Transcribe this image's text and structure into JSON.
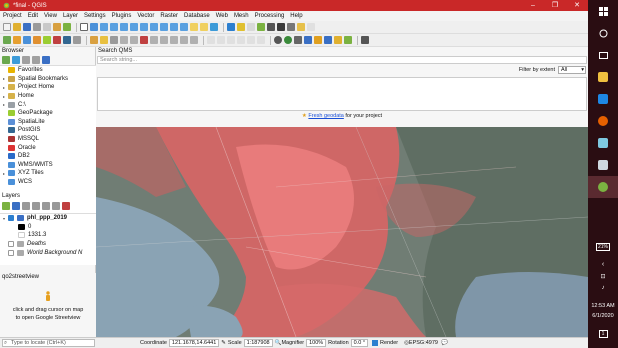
{
  "window": {
    "title": "*final - QGIS",
    "min": "–",
    "max": "❐",
    "close": "✕"
  },
  "menu": [
    "Project",
    "Edit",
    "View",
    "Layer",
    "Settings",
    "Plugins",
    "Vector",
    "Raster",
    "Database",
    "Web",
    "Mesh",
    "Processing",
    "Help"
  ],
  "browser": {
    "title": "Browser",
    "items": [
      {
        "label": "Favorites",
        "icon": "star-icon",
        "color": "#e8b400",
        "arrow": ""
      },
      {
        "label": "Spatial Bookmarks",
        "icon": "bookmark-icon",
        "color": "#c9a34a",
        "arrow": "▸"
      },
      {
        "label": "Project Home",
        "icon": "folder-icon",
        "color": "#d6b24a",
        "arrow": "▸"
      },
      {
        "label": "Home",
        "icon": "home-folder-icon",
        "color": "#d6b24a",
        "arrow": "▸"
      },
      {
        "label": "C:\\",
        "icon": "drive-icon",
        "color": "#9aa0a6",
        "arrow": "▸"
      },
      {
        "label": "GeoPackage",
        "icon": "geopackage-icon",
        "color": "#9acd32",
        "arrow": ""
      },
      {
        "label": "SpatiaLite",
        "icon": "spatialite-icon",
        "color": "#5b8fd6",
        "arrow": ""
      },
      {
        "label": "PostGIS",
        "icon": "postgis-icon",
        "color": "#336791",
        "arrow": ""
      },
      {
        "label": "MSSQL",
        "icon": "mssql-icon",
        "color": "#a33",
        "arrow": ""
      },
      {
        "label": "Oracle",
        "icon": "oracle-icon",
        "color": "#d33",
        "arrow": ""
      },
      {
        "label": "DB2",
        "icon": "db2-icon",
        "color": "#2a6bc9",
        "arrow": ""
      },
      {
        "label": "WMS/WMTS",
        "icon": "wms-icon",
        "color": "#4a90d9",
        "arrow": ""
      },
      {
        "label": "XYZ Tiles",
        "icon": "xyz-tiles-icon",
        "color": "#4a90d9",
        "arrow": "▸"
      },
      {
        "label": "WCS",
        "icon": "wcs-icon",
        "color": "#4a90d9",
        "arrow": ""
      }
    ]
  },
  "layers": {
    "title": "Layers",
    "items": [
      {
        "label": "phl_ppp_2019",
        "bold": true,
        "checked": true
      },
      {
        "label": "0",
        "bold": false,
        "checked": false
      },
      {
        "label": "1331.3",
        "bold": false,
        "checked": false
      },
      {
        "label": "Deaths",
        "bold": false,
        "checked": false
      },
      {
        "label": "World Background N",
        "bold": false,
        "checked": false
      }
    ]
  },
  "qo2": {
    "title": "qo2streetview",
    "line1": "click and drag cursor on map",
    "line2": "to open Google Streetview"
  },
  "qms": {
    "title": "Search QMS",
    "placeholder": "Search string...",
    "filter_label": "Filter by extent",
    "filter_value": "All",
    "foot_link": "Fresh geodata",
    "foot_rest": " for your project"
  },
  "status": {
    "locate_placeholder": "Type to locate (Ctrl+K)",
    "coordinate_label": "Coordinate",
    "coordinate_value": "121.1678,14.6441",
    "scale_label": "Scale",
    "scale_value": "1:187908",
    "magnifier_label": "Magnifier",
    "magnifier_value": "100%",
    "rotation_label": "Rotation",
    "rotation_value": "0.0 °",
    "render_label": "Render",
    "crs": "EPSG:4979"
  },
  "taskbar": {
    "battery": "21%",
    "time": "12:53 AM",
    "date": "6/1/2020",
    "notifications": "1"
  },
  "colors": {
    "titlebar": "#c92828",
    "taskbar": "#2a0d12",
    "map_pop": "#e06a6a",
    "sea": "#8aa3b4",
    "land": "#6c7a73"
  }
}
